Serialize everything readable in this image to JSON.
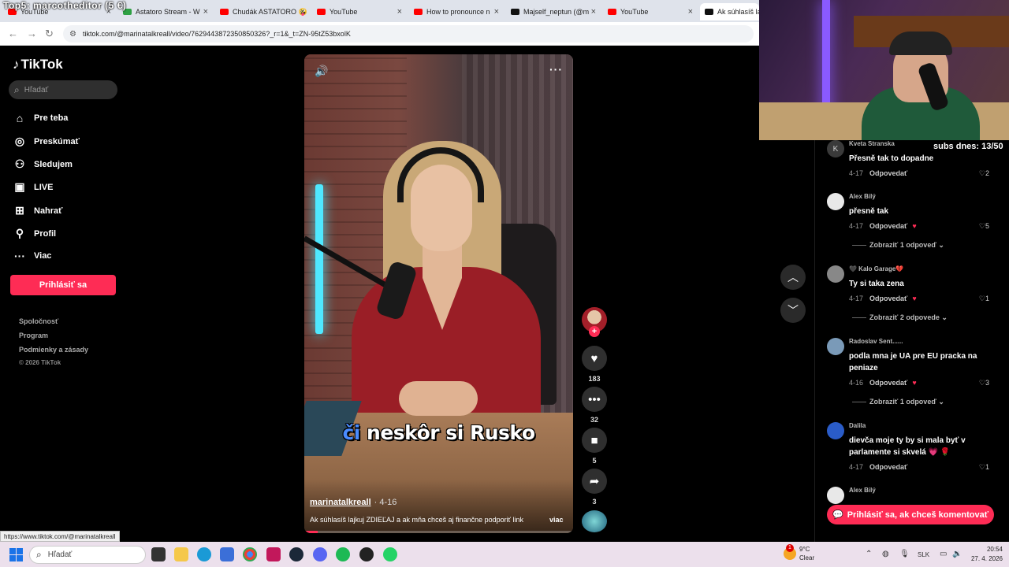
{
  "overlay_text": "Top5: marcotheditor (5 €)",
  "browser": {
    "tabs": [
      {
        "title": "YouTube",
        "color": "#ff0000"
      },
      {
        "title": "Astatoro Stream - W",
        "color": "#2ea043"
      },
      {
        "title": "Chudák ASTATORO 🤪",
        "color": "#ff0000"
      },
      {
        "title": "YouTube",
        "color": "#ff0000"
      },
      {
        "title": "How to pronounce n",
        "color": "#ff0000"
      },
      {
        "title": "Majself_neptun (@m",
        "color": "#111111"
      },
      {
        "title": "YouTube",
        "color": "#ff0000"
      },
      {
        "title": "Ak súhlasíš lajk",
        "color": "#111111"
      }
    ],
    "url": "tiktok.com/@marinatalkreall/video/7629443872350850326?_r=1&_t=ZN-95tZ53bxolK"
  },
  "sidebar": {
    "logo": "TikTok",
    "search_placeholder": "Hľadať",
    "nav": [
      {
        "label": "Pre teba",
        "icon": "home-icon"
      },
      {
        "label": "Preskúmať",
        "icon": "compass-icon"
      },
      {
        "label": "Sledujem",
        "icon": "following-icon"
      },
      {
        "label": "LIVE",
        "icon": "live-icon"
      },
      {
        "label": "Nahrať",
        "icon": "upload-icon"
      },
      {
        "label": "Profil",
        "icon": "profile-icon"
      },
      {
        "label": "Viac",
        "icon": "more-icon"
      }
    ],
    "login_label": "Prihlásiť sa",
    "footer": [
      "Spoločnosť",
      "Program",
      "Podmienky a zásady"
    ],
    "copyright": "© 2026 TikTok"
  },
  "video": {
    "caption_highlight": "či",
    "caption_rest": " neskôr si Rusko",
    "username": "marinatalkreall",
    "date": "· 4-16",
    "description": "Ak súhlasíš lajkuj ZDIEĽAJ a ak mňa chceš aj finančne podporiť link",
    "more_label": "viac",
    "progress": 0.05
  },
  "actions": {
    "likes": "183",
    "comments": "32",
    "saves": "5",
    "shares": "3"
  },
  "comments": {
    "subs_text": "subs dnes: 13/50",
    "items": [
      {
        "name": "Kveta Stranska",
        "text": "Přesně tak to dopadne",
        "date": "4-17",
        "reply": "Odpovedať",
        "likes": "2",
        "avatar_letter": "K",
        "avatar_color": "#3a3a3a",
        "creator_liked": false,
        "replies": ""
      },
      {
        "name": "Alex Bilý",
        "text": "přesně tak",
        "date": "4-17",
        "reply": "Odpovedať",
        "likes": "5",
        "avatar_letter": "",
        "avatar_color": "#e8e8e8",
        "creator_liked": true,
        "replies": "Zobraziť 1 odpoveď"
      },
      {
        "name": "🖤 Kalo Garage💔",
        "text": "Ty si taka zena",
        "date": "4-17",
        "reply": "Odpovedať",
        "likes": "1",
        "avatar_letter": "",
        "avatar_color": "#888888",
        "creator_liked": true,
        "replies": "Zobraziť 2 odpovede"
      },
      {
        "name": "Radoslav Sent......",
        "text": "podla mna je UA pre EU pracka na peniaze",
        "date": "4-16",
        "reply": "Odpovedať",
        "likes": "3",
        "avatar_letter": "",
        "avatar_color": "#7a9ab8",
        "creator_liked": true,
        "replies": "Zobraziť 1 odpoveď"
      },
      {
        "name": "Dalila",
        "text": "dievča moje ty by si mala byť v parlamente si skvelá 💗 🌹",
        "date": "4-17",
        "reply": "Odpovedať",
        "likes": "1",
        "avatar_letter": "",
        "avatar_color": "#2a5cc8",
        "creator_liked": false,
        "replies": ""
      },
      {
        "name": "Alex Bilý",
        "text": "",
        "date": "",
        "reply": "",
        "likes": "",
        "avatar_letter": "",
        "avatar_color": "#e8e8e8",
        "creator_liked": false,
        "replies": ""
      }
    ],
    "login_prompt": "Prihlásiť sa, ak chceš komentovať"
  },
  "status_link": "https://www.tiktok.com/@marinatalkreall",
  "taskbar": {
    "search_placeholder": "Hľadať",
    "weather_temp": "9°C",
    "weather_desc": "Clear",
    "weather_badge": "1",
    "language": "SLK",
    "time": "20:54",
    "date": "27. 4. 2026"
  }
}
